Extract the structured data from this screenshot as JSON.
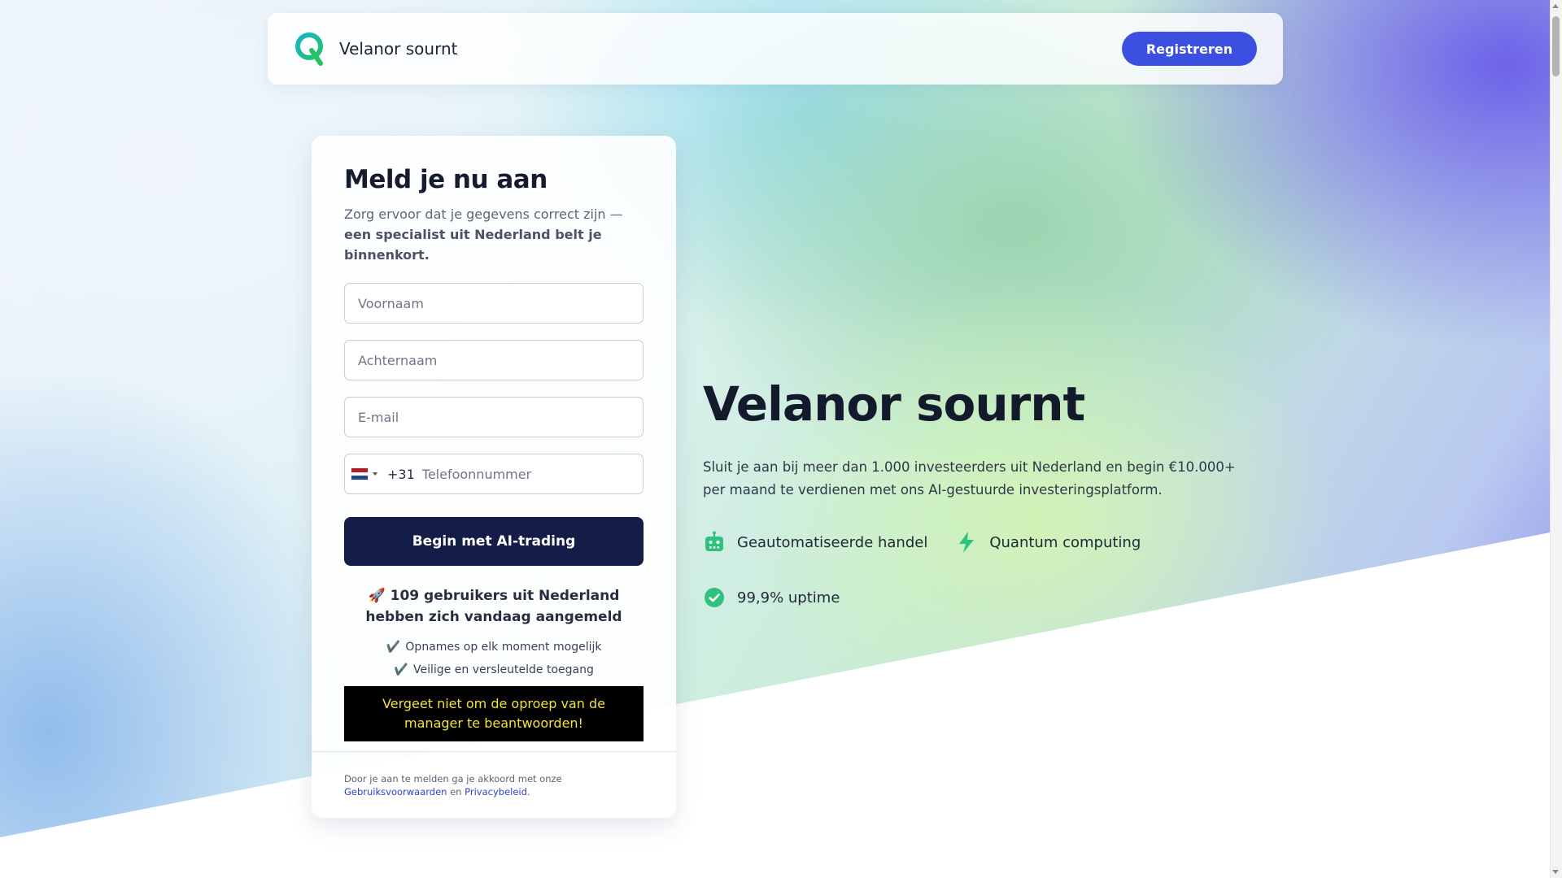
{
  "header": {
    "brand_name": "Velanor sournt",
    "register_label": "Registreren"
  },
  "form": {
    "title": "Meld je nu aan",
    "subtitle_plain": "Zorg ervoor dat je gegevens correct zijn — ",
    "subtitle_bold": "een specialist uit Nederland belt je binnenkort.",
    "first_name_placeholder": "Voornaam",
    "last_name_placeholder": "Achternaam",
    "email_placeholder": "E-mail",
    "phone_dial_code": "+31",
    "phone_placeholder": "Telefoonnummer",
    "submit_label": "Begin met AI-trading",
    "signups_text": "🚀 109 gebruikers uit Nederland hebben zich vandaag aangemeld",
    "checks": [
      "Opnames op elk moment mogelijk",
      "Veilige en versleutelde toegang"
    ],
    "check_glyph": "✔️",
    "notice": "Vergeet niet om de oproep van de manager te beantwoorden!",
    "legal_prefix": "Door je aan te melden ga je akkoord met onze ",
    "legal_terms": "Gebruiksvoorwaarden",
    "legal_and": " en ",
    "legal_privacy": "Privacybeleid",
    "legal_suffix": "."
  },
  "hero": {
    "title": "Velanor sournt",
    "text": "Sluit je aan bij meer dan 1.000 investeerders uit Nederland en begin €10.000+ per maand te verdienen met ons AI-gestuurde investeringsplatform.",
    "features": [
      {
        "label": "Geautomatiseerde handel",
        "icon": "robot-icon"
      },
      {
        "label": "Quantum computing",
        "icon": "lightning-icon"
      },
      {
        "label": "99,9% uptime",
        "icon": "check-circle-icon"
      }
    ]
  },
  "colors": {
    "accent_button": "#3b4fe0",
    "cta_button": "#141d47",
    "feature_icon": "#2ec27e",
    "notice_bg": "#000000",
    "notice_text": "#f2e23a",
    "logo_teal": "#19b3c9",
    "logo_green": "#22c55e"
  }
}
